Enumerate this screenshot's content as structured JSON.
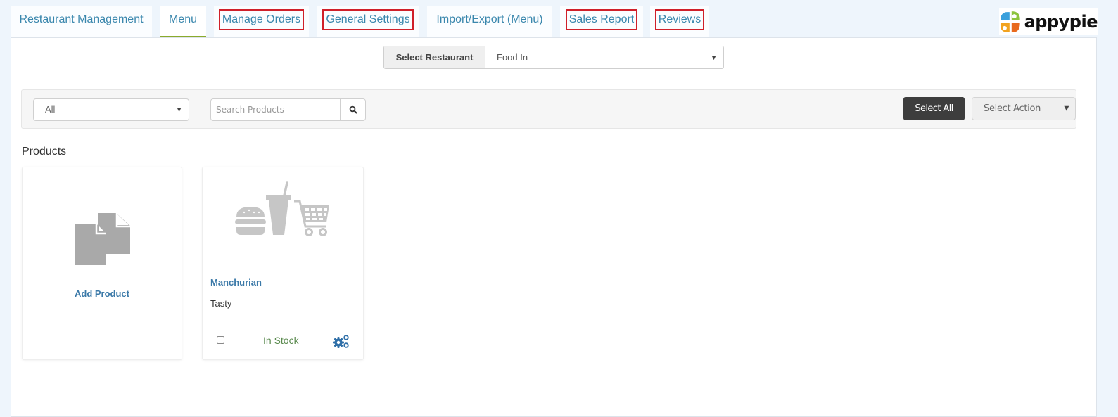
{
  "tabs": [
    {
      "label": "Restaurant Management",
      "active": false,
      "highlighted": false
    },
    {
      "label": "Menu",
      "active": true,
      "highlighted": false
    },
    {
      "label": "Manage Orders",
      "active": false,
      "highlighted": true
    },
    {
      "label": "General Settings",
      "active": false,
      "highlighted": true
    },
    {
      "label": "Import/Export (Menu)",
      "active": false,
      "highlighted": false
    },
    {
      "label": "Sales Report",
      "active": false,
      "highlighted": true
    },
    {
      "label": "Reviews",
      "active": false,
      "highlighted": true
    }
  ],
  "logo": {
    "text": "appypie"
  },
  "restaurant_selector": {
    "label": "Select Restaurant",
    "value": "Food In"
  },
  "toolbar": {
    "category_filter": "All",
    "search_placeholder": "Search Products",
    "select_all_label": "Select All",
    "action_select": "Select Action"
  },
  "products_section": {
    "heading": "Products",
    "add_product_label": "Add Product",
    "items": [
      {
        "name": "Manchurian",
        "description": "Tasty",
        "status": "In Stock",
        "checked": false
      }
    ]
  },
  "colors": {
    "link": "#3b79a8",
    "tab_text": "#3a87ad",
    "active_tab_underline": "#8aaa2c",
    "highlight_box": "#d0202a",
    "in_stock": "#5a8a4e"
  }
}
